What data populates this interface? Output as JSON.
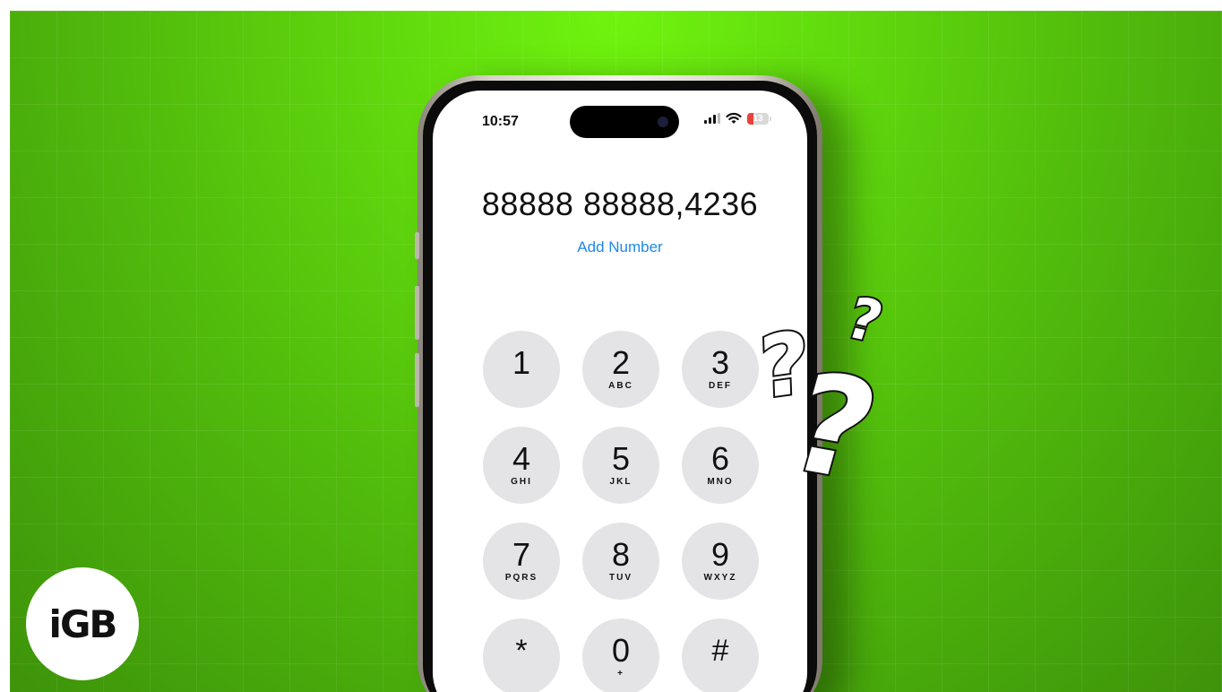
{
  "status_bar": {
    "time": "10:57",
    "battery_level": "13"
  },
  "dialer": {
    "number": "88888 88888,4236",
    "add_number_label": "Add Number",
    "keys": [
      {
        "digit": "1",
        "letters": ""
      },
      {
        "digit": "2",
        "letters": "ABC"
      },
      {
        "digit": "3",
        "letters": "DEF"
      },
      {
        "digit": "4",
        "letters": "GHI"
      },
      {
        "digit": "5",
        "letters": "JKL"
      },
      {
        "digit": "6",
        "letters": "MNO"
      },
      {
        "digit": "7",
        "letters": "PQRS"
      },
      {
        "digit": "8",
        "letters": "TUV"
      },
      {
        "digit": "9",
        "letters": "WXYZ"
      },
      {
        "digit": "*",
        "letters": ""
      },
      {
        "digit": "0",
        "letters": "+"
      },
      {
        "digit": "#",
        "letters": ""
      }
    ]
  },
  "logo": {
    "text": "iGB"
  },
  "decorations": {
    "question_mark": "?"
  },
  "colors": {
    "background": "#5ccf0d",
    "link": "#1e87e8",
    "key": "#e4e4e6"
  }
}
